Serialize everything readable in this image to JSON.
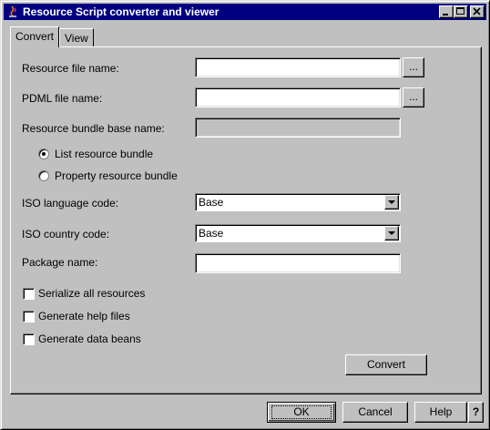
{
  "window": {
    "title": "Resource Script converter and viewer"
  },
  "tabs": [
    {
      "label": "Convert",
      "active": true
    },
    {
      "label": "View",
      "active": false
    }
  ],
  "form": {
    "resource_file_label": "Resource file name:",
    "resource_file_value": "",
    "pdml_file_label": "PDML file name:",
    "pdml_file_value": "",
    "browse_label": "...",
    "bundle_base_label": "Resource bundle base name:",
    "bundle_base_value": "",
    "radio_list_label": "List resource bundle",
    "radio_property_label": "Property resource bundle",
    "radio_selected": "list",
    "iso_language_label": "ISO language code:",
    "iso_language_value": "Base",
    "iso_country_label": "ISO country code:",
    "iso_country_value": "Base",
    "package_label": "Package name:",
    "package_value": "",
    "serialize_label": "Serialize all resources",
    "help_files_label": "Generate help files",
    "data_beans_label": "Generate data beans",
    "convert_label": "Convert"
  },
  "footer": {
    "ok_label": "OK",
    "cancel_label": "Cancel",
    "help_label": "Help",
    "question_label": "?"
  },
  "colors": {
    "titlebar": "#000080",
    "face": "#c0c0c0"
  }
}
